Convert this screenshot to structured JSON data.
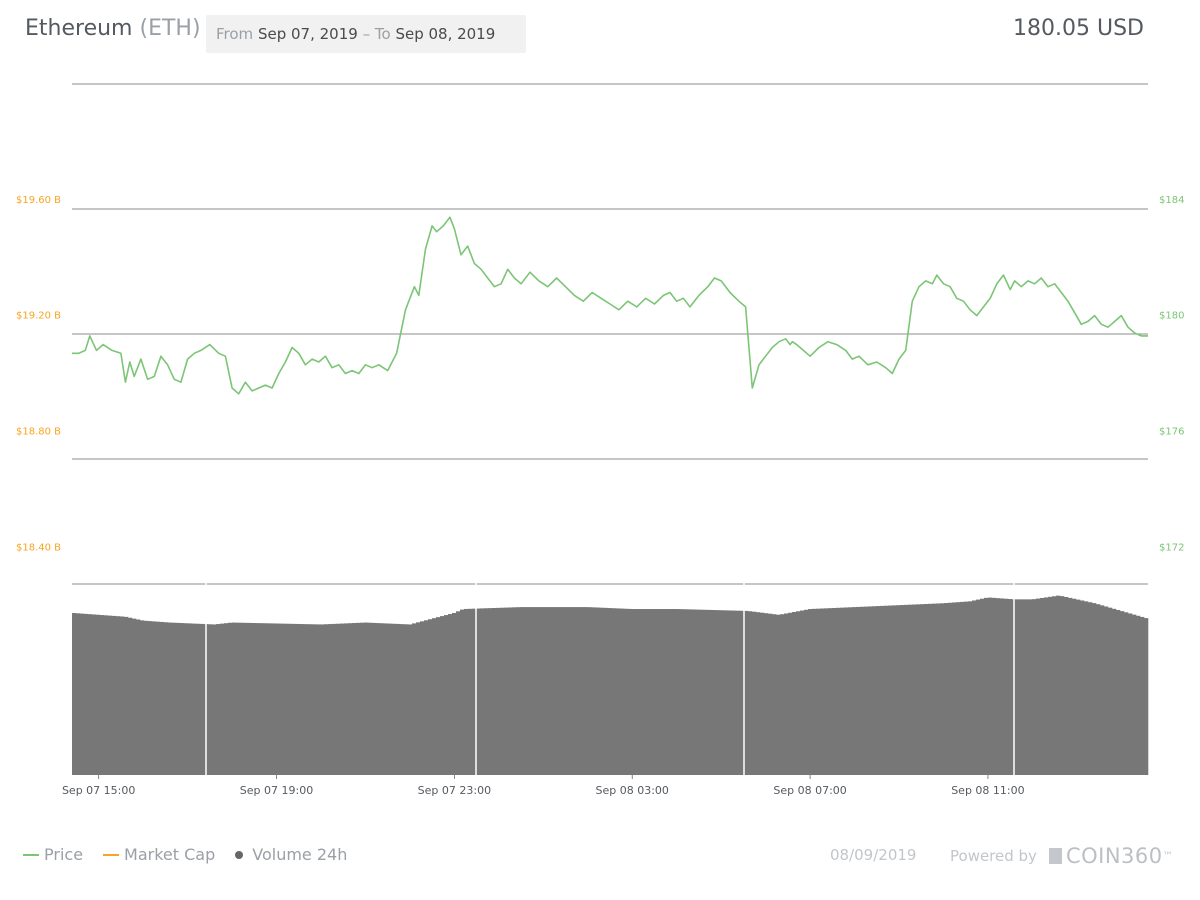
{
  "header": {
    "coin_name": "Ethereum",
    "coin_symbol": "(ETH)",
    "from_label": "From",
    "from_date": "Sep 07, 2019",
    "separator": "–",
    "to_label": "To",
    "to_date": "Sep 08, 2019",
    "current_price": "180.05 USD"
  },
  "legend": {
    "price_label": "Price",
    "market_cap_label": "Market Cap",
    "volume_label": "Volume 24h"
  },
  "footer": {
    "date": "08/09/2019",
    "powered_by": "Powered by",
    "brand": "COIN360",
    "trademark": "™"
  },
  "colors": {
    "price": "#7cc576",
    "market_cap": "#f5a623",
    "volume": "#777777",
    "grid": "#666666",
    "text_muted": "#9aa0a6"
  },
  "chart_data": {
    "type": "line",
    "x_tick_labels": [
      "Sep 07 15:00",
      "Sep 07 19:00",
      "Sep 07 23:00",
      "Sep 08 03:00",
      "Sep 08 07:00",
      "Sep 08 11:00"
    ],
    "x_range_hours": [
      14.4,
      38.6
    ],
    "left_axis": {
      "name": "Market Cap",
      "tick_labels": [
        "$19.60 B",
        "$19.20 B",
        "$18.80 B",
        "$18.40 B"
      ],
      "ticks": [
        19.6,
        19.2,
        18.8,
        18.4
      ]
    },
    "right_axis": {
      "name": "Price",
      "tick_labels": [
        "$184",
        "$180",
        "$176",
        "$172"
      ],
      "ticks": [
        184,
        180,
        176,
        172
      ],
      "range": [
        170.8,
        188
      ]
    },
    "grid": true,
    "series": [
      {
        "name": "Price",
        "axis": "right",
        "x_hours": [
          14.4,
          14.55,
          14.7,
          14.8,
          14.95,
          15.1,
          15.3,
          15.5,
          15.6,
          15.7,
          15.8,
          15.95,
          16.1,
          16.25,
          16.4,
          16.55,
          16.7,
          16.85,
          17.0,
          17.15,
          17.3,
          17.5,
          17.7,
          17.85,
          18.0,
          18.15,
          18.3,
          18.45,
          18.6,
          18.75,
          18.9,
          19.05,
          19.2,
          19.35,
          19.5,
          19.65,
          19.8,
          19.95,
          20.1,
          20.25,
          20.4,
          20.55,
          20.7,
          20.85,
          21.0,
          21.15,
          21.3,
          21.5,
          21.7,
          21.9,
          22.1,
          22.2,
          22.35,
          22.5,
          22.6,
          22.75,
          22.9,
          23.0,
          23.15,
          23.3,
          23.45,
          23.6,
          23.75,
          23.9,
          24.05,
          24.2,
          24.35,
          24.5,
          24.7,
          24.9,
          25.1,
          25.3,
          25.5,
          25.7,
          25.9,
          26.1,
          26.3,
          26.5,
          26.7,
          26.9,
          27.1,
          27.3,
          27.5,
          27.7,
          27.85,
          28.0,
          28.15,
          28.3,
          28.5,
          28.7,
          28.85,
          29.0,
          29.2,
          29.4,
          29.55,
          29.7,
          29.85,
          30.0,
          30.15,
          30.3,
          30.45,
          30.55,
          30.6,
          30.7,
          30.85,
          31.0,
          31.2,
          31.4,
          31.6,
          31.8,
          31.95,
          32.1,
          32.3,
          32.5,
          32.7,
          32.85,
          33.0,
          33.15,
          33.3,
          33.45,
          33.6,
          33.75,
          33.85,
          34.0,
          34.15,
          34.3,
          34.45,
          34.6,
          34.75,
          34.9,
          35.05,
          35.2,
          35.35,
          35.5,
          35.6,
          35.75,
          35.9,
          36.05,
          36.2,
          36.35,
          36.5,
          36.65,
          36.8,
          36.95,
          37.1,
          37.25,
          37.4,
          37.55,
          37.7,
          37.85,
          38.0,
          38.15,
          38.3,
          38.45,
          38.6
        ],
        "values": [
          178.7,
          178.7,
          178.8,
          179.3,
          178.8,
          179.0,
          178.8,
          178.7,
          177.7,
          178.4,
          177.9,
          178.5,
          177.8,
          177.9,
          178.6,
          178.3,
          177.8,
          177.7,
          178.5,
          178.7,
          178.8,
          179.0,
          178.7,
          178.6,
          177.5,
          177.3,
          177.7,
          177.4,
          177.5,
          177.6,
          177.5,
          178.0,
          178.4,
          178.9,
          178.7,
          178.3,
          178.5,
          178.4,
          178.6,
          178.2,
          178.3,
          178.0,
          178.1,
          178.0,
          178.3,
          178.2,
          178.3,
          178.1,
          178.7,
          180.2,
          181.0,
          180.7,
          182.3,
          183.1,
          182.9,
          183.1,
          183.4,
          183.0,
          182.1,
          182.4,
          181.8,
          181.6,
          181.3,
          181.0,
          181.1,
          181.6,
          181.3,
          181.1,
          181.5,
          181.2,
          181.0,
          181.3,
          181.0,
          180.7,
          180.5,
          180.8,
          180.6,
          180.4,
          180.2,
          180.5,
          180.3,
          180.6,
          180.4,
          180.7,
          180.8,
          180.5,
          180.6,
          180.3,
          180.7,
          181.0,
          181.3,
          181.2,
          180.8,
          180.5,
          180.3,
          177.5,
          178.3,
          178.6,
          178.9,
          179.1,
          179.2,
          179.0,
          179.1,
          179.0,
          178.8,
          178.6,
          178.9,
          179.1,
          179.0,
          178.8,
          178.5,
          178.6,
          178.3,
          178.4,
          178.2,
          178.0,
          178.5,
          178.8,
          180.5,
          181.0,
          181.2,
          181.1,
          181.4,
          181.1,
          181.0,
          180.6,
          180.5,
          180.2,
          180.0,
          180.3,
          180.6,
          181.1,
          181.4,
          180.9,
          181.2,
          181.0,
          181.2,
          181.1,
          181.3,
          181.0,
          181.1,
          180.8,
          180.5,
          180.1,
          179.7,
          179.8,
          180.0,
          179.7,
          179.6,
          179.8,
          180.0,
          179.6,
          179.4,
          179.3,
          179.3
        ]
      },
      {
        "name": "Volume 24h",
        "axis": "none",
        "x_hours": [
          14.4,
          15.6,
          16.0,
          16.6,
          17.6,
          18.0,
          20.0,
          21.0,
          22.0,
          23.0,
          23.2,
          24.5,
          26.0,
          27.0,
          28.0,
          29.6,
          30.3,
          31.0,
          32.0,
          33.0,
          34.0,
          34.6,
          35.0,
          35.6,
          36.0,
          36.6,
          37.0,
          37.4,
          38.6
        ],
        "values": [
          0.84,
          0.82,
          0.8,
          0.79,
          0.78,
          0.79,
          0.78,
          0.79,
          0.78,
          0.84,
          0.86,
          0.87,
          0.87,
          0.86,
          0.86,
          0.85,
          0.83,
          0.86,
          0.87,
          0.88,
          0.89,
          0.9,
          0.92,
          0.91,
          0.91,
          0.93,
          0.91,
          0.89,
          0.81
        ]
      }
    ]
  }
}
